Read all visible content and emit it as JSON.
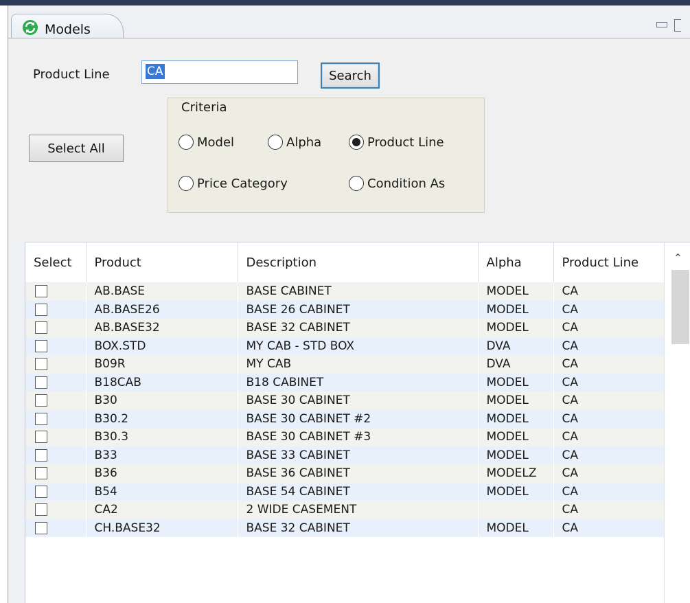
{
  "window": {
    "tab_title": "Models",
    "tab_icon": "refresh-icon"
  },
  "form": {
    "product_line_label": "Product Line",
    "product_line_value": "CA",
    "search_label": "Search",
    "select_all_label": "Select All"
  },
  "criteria": {
    "title": "Criteria",
    "selected": "Product Line",
    "options": [
      "Model",
      "Alpha",
      "Product Line",
      "Price Category",
      "Condition As"
    ]
  },
  "table": {
    "columns": [
      "Select",
      "Product",
      "Description",
      "Alpha",
      "Product Line"
    ],
    "rows": [
      {
        "product": "AB.BASE",
        "description": "BASE CABINET",
        "alpha": "MODEL",
        "product_line": "CA"
      },
      {
        "product": "AB.BASE26",
        "description": "BASE 26 CABINET",
        "alpha": "MODEL",
        "product_line": "CA"
      },
      {
        "product": "AB.BASE32",
        "description": "BASE 32 CABINET",
        "alpha": "MODEL",
        "product_line": "CA"
      },
      {
        "product": "BOX.STD",
        "description": "MY CAB - STD BOX",
        "alpha": "DVA",
        "product_line": "CA"
      },
      {
        "product": "B09R",
        "description": "MY CAB",
        "alpha": "DVA",
        "product_line": "CA"
      },
      {
        "product": "B18CAB",
        "description": "B18 CABINET",
        "alpha": "MODEL",
        "product_line": "CA"
      },
      {
        "product": "B30",
        "description": "BASE 30 CABINET",
        "alpha": "MODEL",
        "product_line": "CA"
      },
      {
        "product": "B30.2",
        "description": "BASE 30 CABINET #2",
        "alpha": "MODEL",
        "product_line": "CA"
      },
      {
        "product": "B30.3",
        "description": "BASE 30 CABINET #3",
        "alpha": "MODEL",
        "product_line": "CA"
      },
      {
        "product": "B33",
        "description": "BASE 33 CABINET",
        "alpha": "MODEL",
        "product_line": "CA"
      },
      {
        "product": "B36",
        "description": "BASE 36 CABINET",
        "alpha": "MODELZ",
        "product_line": "CA"
      },
      {
        "product": "B54",
        "description": "BASE 54 CABINET",
        "alpha": "MODEL",
        "product_line": "CA"
      },
      {
        "product": "CA2",
        "description": "2 WIDE CASEMENT",
        "alpha": "",
        "product_line": "CA"
      },
      {
        "product": "CH.BASE32",
        "description": "BASE 32 CABINET",
        "alpha": "MODEL",
        "product_line": "CA"
      }
    ]
  },
  "colors": {
    "accent": "#3a78d6",
    "row_odd": "#f2f2ee",
    "row_even": "#e8f0fb"
  }
}
